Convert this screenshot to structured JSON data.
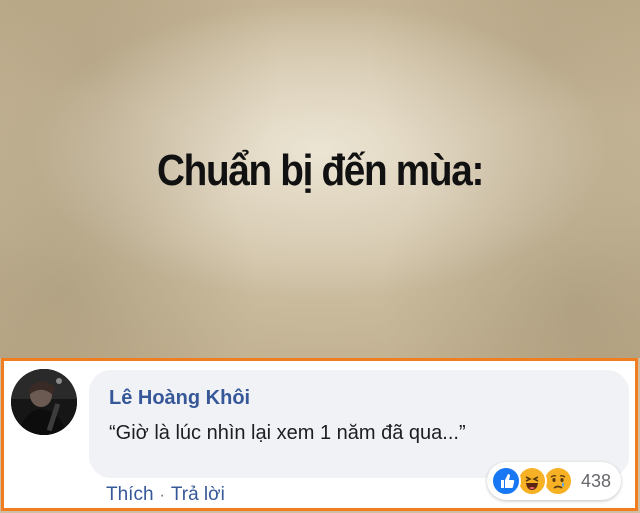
{
  "meme": {
    "title": "Chuẩn bị đến mùa:"
  },
  "comment": {
    "author": "Lê Hoàng Khôi",
    "text": "“Giờ là lúc nhìn lại xem 1 năm đã qua...”",
    "reaction_count": "438",
    "reactions": [
      "like-icon",
      "haha-icon",
      "sad-icon"
    ],
    "actions": {
      "like_label": "Thích",
      "separator": "·",
      "reply_label": "Trả lời"
    }
  },
  "colors": {
    "highlight_border": "#f07d1f",
    "author_link": "#365899",
    "bubble_bg": "#f0f2f5",
    "like_blue": "#1877f2",
    "reaction_yellow": "#f7b125"
  }
}
